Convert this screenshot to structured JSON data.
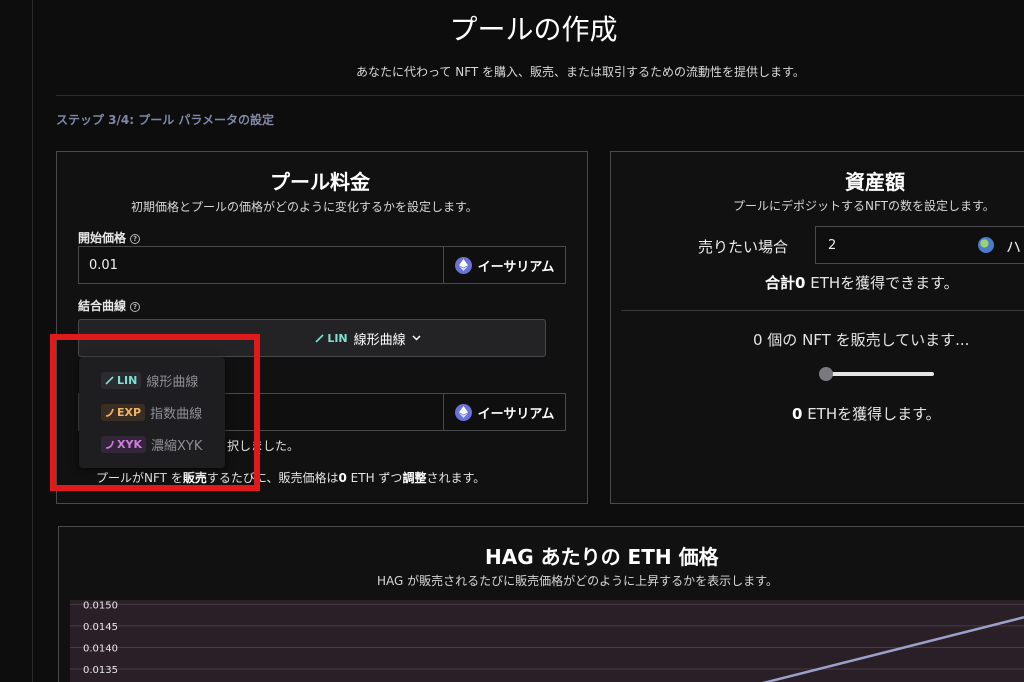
{
  "page": {
    "title": "プールの作成",
    "subtitle": "あなたに代わって NFT を購入、販売、または取引するための流動性を提供します。",
    "step": "ステップ 3/4: プール パラメータの設定"
  },
  "pool_fee": {
    "title": "プール料金",
    "description": "初期価格とプールの価格がどのように変化するかを設定します。",
    "start_price_label": "開始価格",
    "start_price_value": "0.01",
    "currency_label": "イーサリアム",
    "curve_label": "結合曲線",
    "selected_curve_tag": "LIN",
    "selected_curve_name": "線形曲線",
    "delta_currency_label": "イーサリアム",
    "partial_text_1": "択しました。",
    "info_text_prefix": "プールがNFT を",
    "info_text_bold": "販売",
    "info_text_mid": "するたびに、販売価格は",
    "info_text_value": "0",
    "info_text_suffix": " ETH ずつ",
    "info_text_adjust": "調整",
    "info_text_end": "されます。"
  },
  "curve_options": [
    {
      "tag": "LIN",
      "name": "線形曲線"
    },
    {
      "tag": "EXP",
      "name": "指数曲線"
    },
    {
      "tag": "XYK",
      "name": "濃縮XYK"
    }
  ],
  "assets": {
    "title": "資産額",
    "description": "プールにデポジットするNFTの数を設定します。",
    "sell_label": "売りたい場合",
    "sell_value": "2",
    "sell_unit_partial": "ハ",
    "total_prefix": "合計",
    "total_value": "0",
    "total_suffix": " ETHを獲得できます。",
    "selling_text": "0 個の NFT を販売しています...",
    "slider_value": 0,
    "earn_value": "0",
    "earn_suffix": " ETHを獲得します。"
  },
  "chart": {
    "title": "HAG あたりの ETH 価格",
    "subtitle": "HAG が販売されるたびに販売価格がどのように上昇するかを表示します。"
  },
  "chart_data": {
    "type": "line",
    "title": "HAG あたりの ETH 価格",
    "y_tick_labels": [
      "0.0150",
      "0.0145",
      "0.0140",
      "0.0135"
    ],
    "ylim": [
      0.0132,
      0.0151
    ],
    "series": [
      {
        "values": [
          0.0131,
          0.0147
        ]
      }
    ],
    "grid": true,
    "colors": {
      "line": "#9aa0c8",
      "background": "#2a1f26"
    }
  },
  "colors": {
    "highlight": "#e01a1a",
    "eth_icon": "#6a72d9",
    "lin": "#7de0d6",
    "exp": "#f0b36a",
    "xyk": "#d07de0"
  }
}
